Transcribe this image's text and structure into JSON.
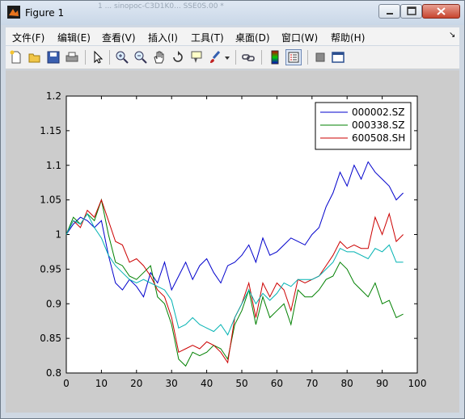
{
  "window": {
    "title": "Figure 1",
    "ghost_title": "1 ... sinopoc-C3D1K0...  SSE0S.00 *"
  },
  "menu": [
    {
      "label": "文件(F)"
    },
    {
      "label": "编辑(E)"
    },
    {
      "label": "查看(V)"
    },
    {
      "label": "插入(I)"
    },
    {
      "label": "工具(T)"
    },
    {
      "label": "桌面(D)"
    },
    {
      "label": "窗口(W)"
    },
    {
      "label": "帮助(H)"
    }
  ],
  "toolbar": {
    "icons": [
      "new-figure-icon",
      "open-icon",
      "save-icon",
      "print-icon",
      "edit-plot-icon",
      "zoom-in-icon",
      "zoom-out-icon",
      "pan-icon",
      "rotate-icon",
      "data-cursor-icon",
      "brush-icon",
      "brush-dropdown-icon",
      "link-icon",
      "colorbar-icon",
      "legend-icon",
      "hide-tools-icon",
      "show-tools-icon"
    ]
  },
  "chart_data": {
    "type": "line",
    "xlim": [
      0,
      100
    ],
    "ylim": [
      0.8,
      1.2
    ],
    "xticks": [
      "0",
      "10",
      "20",
      "30",
      "40",
      "50",
      "60",
      "70",
      "80",
      "90",
      "100"
    ],
    "yticks": [
      "0.8",
      "0.85",
      "0.9",
      "0.95",
      "1",
      "1.05",
      "1.1",
      "1.15",
      "1.2"
    ],
    "legend_position": "top-right",
    "grid": false,
    "series": [
      {
        "name": "000002.SZ",
        "color": "#0000cc",
        "x": [
          0,
          2,
          4,
          6,
          8,
          10,
          12,
          14,
          16,
          18,
          20,
          22,
          24,
          26,
          28,
          30,
          32,
          34,
          36,
          38,
          40,
          42,
          44,
          46,
          48,
          50,
          52,
          54,
          56,
          58,
          60,
          62,
          64,
          66,
          68,
          70,
          72,
          74,
          76,
          78,
          80,
          82,
          84,
          86,
          88,
          90,
          92,
          94,
          96
        ],
        "y": [
          1.0,
          1.015,
          1.025,
          1.02,
          1.01,
          1.02,
          0.97,
          0.93,
          0.92,
          0.935,
          0.925,
          0.91,
          0.945,
          0.93,
          0.96,
          0.92,
          0.94,
          0.96,
          0.935,
          0.955,
          0.965,
          0.945,
          0.93,
          0.955,
          0.96,
          0.97,
          0.985,
          0.96,
          0.995,
          0.97,
          0.975,
          0.985,
          0.995,
          0.99,
          0.985,
          1.0,
          1.01,
          1.04,
          1.06,
          1.09,
          1.07,
          1.1,
          1.08,
          1.105,
          1.09,
          1.08,
          1.07,
          1.05,
          1.06
        ]
      },
      {
        "name": "000338.SZ",
        "color": "#008000",
        "x": [
          0,
          2,
          4,
          6,
          8,
          10,
          12,
          14,
          16,
          18,
          20,
          22,
          24,
          26,
          28,
          30,
          32,
          34,
          36,
          38,
          40,
          42,
          44,
          46,
          48,
          50,
          52,
          54,
          56,
          58,
          60,
          62,
          64,
          66,
          68,
          70,
          72,
          74,
          76,
          78,
          80,
          82,
          84,
          86,
          88,
          90,
          92,
          94,
          96
        ],
        "y": [
          1.0,
          1.025,
          1.015,
          1.03,
          1.02,
          1.05,
          1.0,
          0.96,
          0.955,
          0.94,
          0.935,
          0.945,
          0.955,
          0.91,
          0.9,
          0.87,
          0.82,
          0.81,
          0.83,
          0.825,
          0.83,
          0.84,
          0.835,
          0.82,
          0.87,
          0.89,
          0.92,
          0.87,
          0.91,
          0.88,
          0.89,
          0.9,
          0.87,
          0.92,
          0.91,
          0.91,
          0.92,
          0.935,
          0.94,
          0.96,
          0.95,
          0.93,
          0.92,
          0.91,
          0.93,
          0.9,
          0.905,
          0.88,
          0.885
        ]
      },
      {
        "name": "600508.SH",
        "color": "#cc0000",
        "x": [
          0,
          2,
          4,
          6,
          8,
          10,
          12,
          14,
          16,
          18,
          20,
          22,
          24,
          26,
          28,
          30,
          32,
          34,
          36,
          38,
          40,
          42,
          44,
          46,
          48,
          50,
          52,
          54,
          56,
          58,
          60,
          62,
          64,
          66,
          68,
          70,
          72,
          74,
          76,
          78,
          80,
          82,
          84,
          86,
          88,
          90,
          92,
          94,
          96
        ],
        "y": [
          1.0,
          1.02,
          1.01,
          1.035,
          1.025,
          1.05,
          1.02,
          0.99,
          0.985,
          0.96,
          0.965,
          0.955,
          0.94,
          0.92,
          0.91,
          0.88,
          0.83,
          0.835,
          0.84,
          0.835,
          0.845,
          0.84,
          0.83,
          0.815,
          0.88,
          0.9,
          0.93,
          0.88,
          0.93,
          0.91,
          0.93,
          0.92,
          0.89,
          0.935,
          0.93,
          0.935,
          0.94,
          0.955,
          0.97,
          0.99,
          0.98,
          0.985,
          0.98,
          0.98,
          1.025,
          1.0,
          1.03,
          0.99,
          1.0
        ]
      },
      {
        "name": "",
        "color": "#00b2b2",
        "x": [
          0,
          2,
          4,
          6,
          8,
          10,
          12,
          14,
          16,
          18,
          20,
          22,
          24,
          26,
          28,
          30,
          32,
          34,
          36,
          38,
          40,
          42,
          44,
          46,
          48,
          50,
          52,
          54,
          56,
          58,
          60,
          62,
          64,
          66,
          68,
          70,
          72,
          74,
          76,
          78,
          80,
          82,
          84,
          86,
          88,
          90,
          92,
          94,
          96
        ],
        "y": [
          1.0,
          1.02,
          1.015,
          1.03,
          1.01,
          0.995,
          0.97,
          0.955,
          0.945,
          0.935,
          0.93,
          0.935,
          0.93,
          0.925,
          0.92,
          0.905,
          0.865,
          0.87,
          0.88,
          0.87,
          0.865,
          0.86,
          0.87,
          0.855,
          0.88,
          0.9,
          0.92,
          0.9,
          0.915,
          0.905,
          0.915,
          0.93,
          0.925,
          0.935,
          0.935,
          0.935,
          0.94,
          0.95,
          0.96,
          0.98,
          0.975,
          0.975,
          0.97,
          0.965,
          0.98,
          0.975,
          0.985,
          0.96,
          0.96
        ]
      }
    ]
  }
}
